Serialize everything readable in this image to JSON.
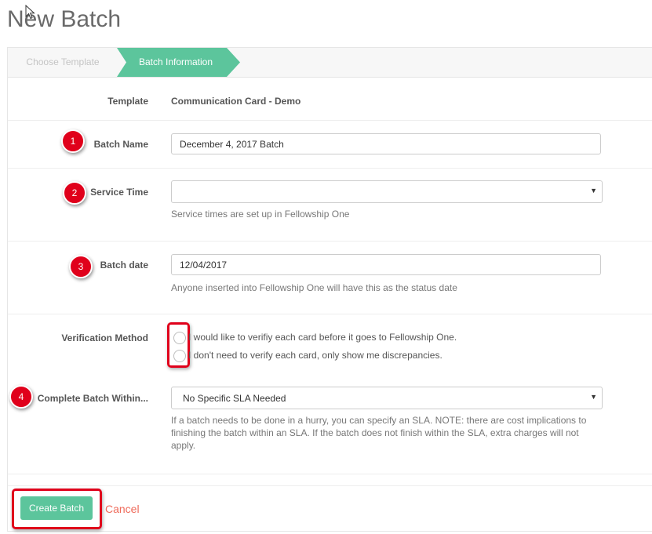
{
  "page": {
    "title": "New Batch"
  },
  "steps": [
    {
      "label": "Choose Template",
      "state": "inactive"
    },
    {
      "label": "Batch Information",
      "state": "active"
    }
  ],
  "form": {
    "template": {
      "label": "Template",
      "value": "Communication Card - Demo"
    },
    "batch_name": {
      "label": "Batch Name",
      "value": "December 4, 2017 Batch",
      "badge": "1"
    },
    "service_time": {
      "label": "Service Time",
      "value": "",
      "help": "Service times are set up in Fellowship One",
      "badge": "2"
    },
    "batch_date": {
      "label": "Batch date",
      "value": "12/04/2017",
      "help": "Anyone inserted into Fellowship One will have this as the status date",
      "badge": "3"
    },
    "verification": {
      "label": "Verification Method",
      "options": [
        "I would like to verifiy each card before it goes to Fellowship One.",
        "I don't need to verify each card, only show me discrepancies."
      ]
    },
    "complete_within": {
      "label": "Complete Batch Within...",
      "value": "No Specific SLA Needed",
      "help_lines": [
        "If a batch needs to be done in a hurry, you can specify an SLA. NOTE: there are cost implications to",
        "finishing the batch within an SLA. If the batch does not finish within the SLA, extra charges will not",
        "apply."
      ],
      "badge": "4"
    }
  },
  "actions": {
    "create_label": "Create Batch",
    "cancel_label": "Cancel"
  },
  "colors": {
    "accent": "#5cc59c",
    "annotation": "#e0001b",
    "cancel": "#ef6b5b"
  },
  "icons": {
    "cursor": "mouse-pointer-icon",
    "dropdown": "caret-down-icon"
  }
}
